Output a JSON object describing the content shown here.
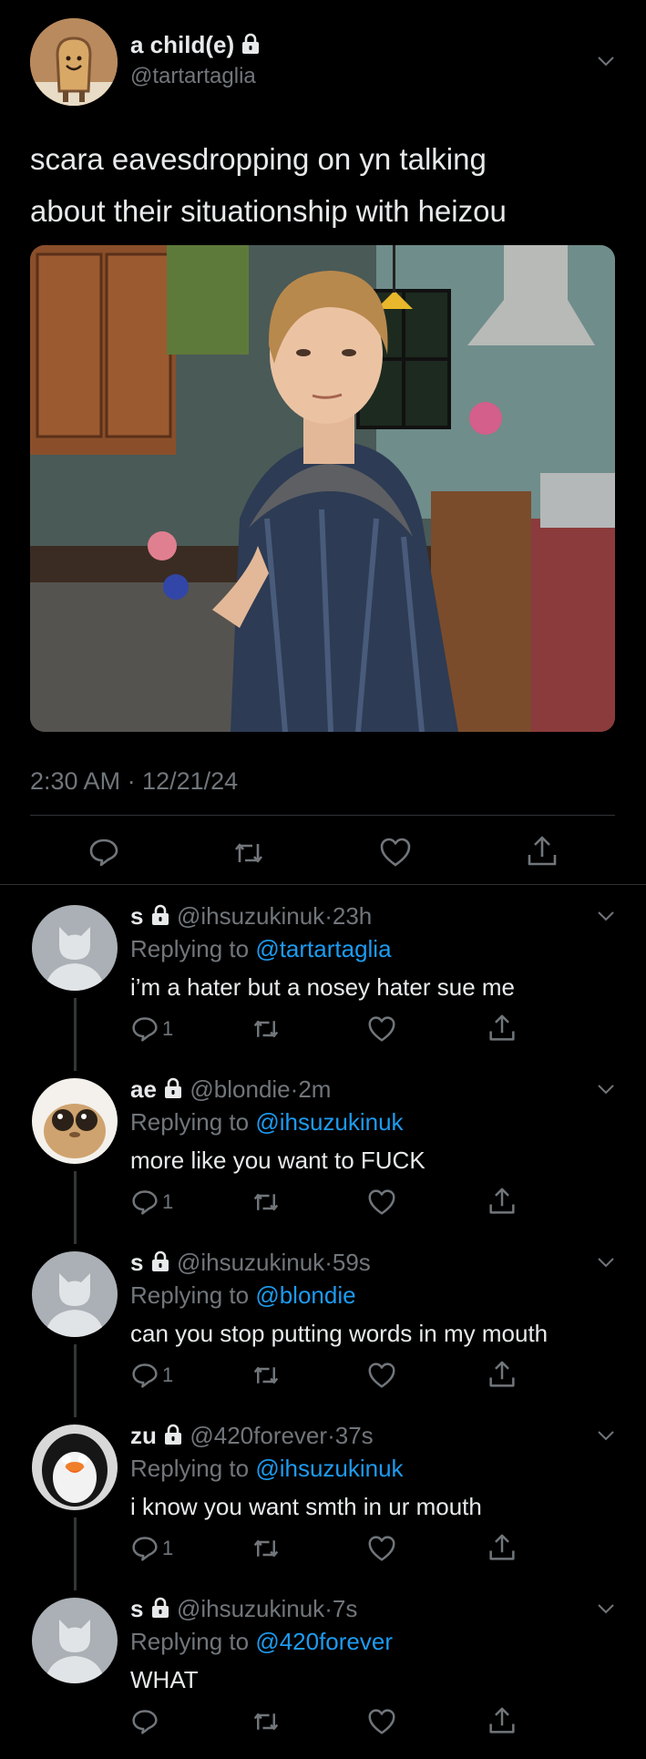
{
  "tweet": {
    "display_name": "a child(e)",
    "handle": "@tartartaglia",
    "text_line1": "scara eavesdropping on yn talking",
    "text_line2": "about their situationship with heizou",
    "timestamp": "2:30 AM · 12/21/24"
  },
  "replies": [
    {
      "name": "s",
      "handle": "@ihsuzukinuk",
      "time": "23h",
      "replying_prefix": "Replying to",
      "replying_to": "@tartartaglia",
      "text": "i’m a hater but a nosey hater sue me",
      "reply_count": "1",
      "avatar": "default"
    },
    {
      "name": "ae",
      "handle": "@blondie",
      "time": "2m",
      "replying_prefix": "Replying to",
      "replying_to": "@ihsuzukinuk",
      "text": "more like you want to FUCK",
      "reply_count": "1",
      "avatar": "creature"
    },
    {
      "name": "s",
      "handle": "@ihsuzukinuk",
      "time": "59s",
      "replying_prefix": "Replying to",
      "replying_to": "@blondie",
      "text": "can you stop putting words in my mouth",
      "reply_count": "1",
      "avatar": "default"
    },
    {
      "name": "zu",
      "handle": "@420forever",
      "time": "37s",
      "replying_prefix": "Replying to",
      "replying_to": "@ihsuzukinuk",
      "text": "i know you want smth in ur mouth",
      "reply_count": "1",
      "avatar": "penguin"
    },
    {
      "name": "s",
      "handle": "@ihsuzukinuk",
      "time": "7s",
      "replying_prefix": "Replying to",
      "replying_to": "@420forever",
      "text": "WHAT",
      "reply_count": "",
      "avatar": "default"
    }
  ],
  "colors": {
    "background": "#000000",
    "text": "#e7e9ea",
    "muted": "#71767b",
    "link": "#1d9bf0"
  }
}
